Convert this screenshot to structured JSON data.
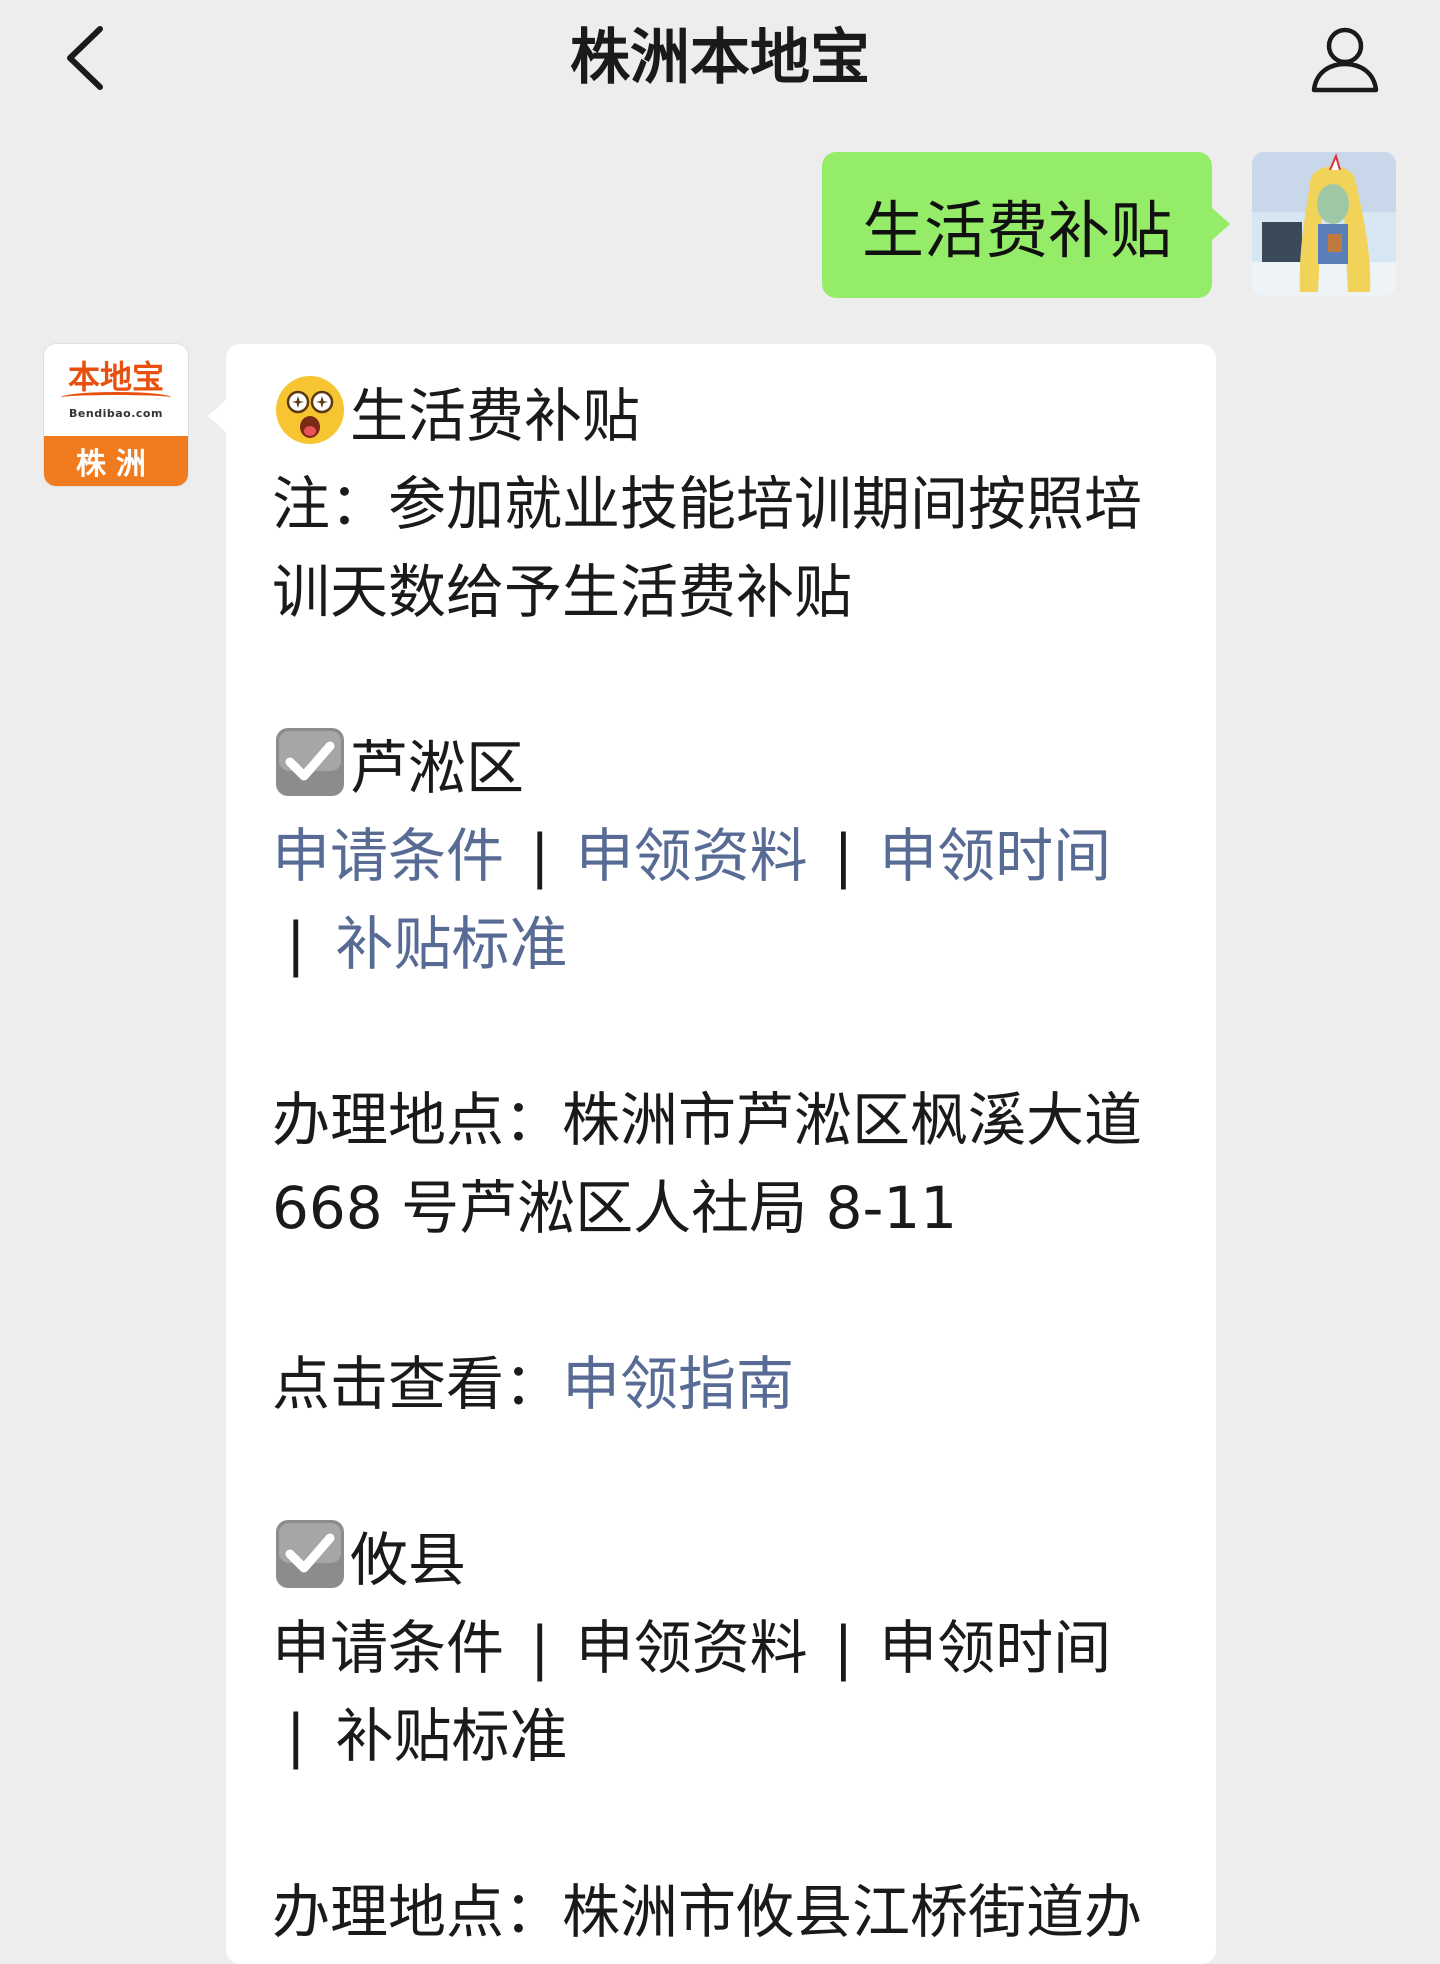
{
  "nav": {
    "title": "株洲本地宝",
    "back_icon": "chevron-left-icon",
    "profile_icon": "person-icon"
  },
  "user_message": {
    "text": "生活费补贴"
  },
  "bot": {
    "avatar_brand": "本地宝",
    "avatar_domain": "Bendibao.com",
    "avatar_city": "株洲",
    "heading": "生活费补贴",
    "note_line1": "注：参加就业技能培训期间按照培",
    "note_line2": "训天数给予生活费补贴",
    "sections": [
      {
        "name": "芦淞区",
        "links": [
          "申请条件",
          "申领资料",
          "申领时间",
          "补贴标准"
        ],
        "address_line1": "办理地点：株洲市芦淞区枫溪大道",
        "address_line2": "668 号芦淞区人社局 8-11",
        "view_label": "点击查看：",
        "view_link": "申领指南"
      },
      {
        "name": "攸县",
        "items": [
          "申请条件",
          "申领资料",
          "申领时间",
          "补贴标准"
        ],
        "address_partial": "办理地点：株洲市攸县江桥街道办"
      }
    ],
    "separator": "|"
  },
  "colors": {
    "background": "#ededed",
    "user_bubble": "#95ec69",
    "bot_bubble": "#ffffff",
    "link": "#576b95",
    "brand_orange": "#f07a1e"
  }
}
